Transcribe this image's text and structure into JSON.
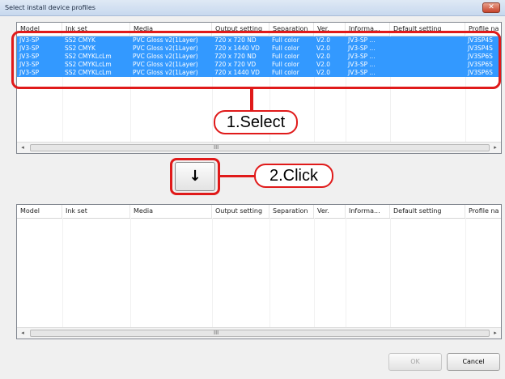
{
  "window": {
    "title": "Select install device profiles",
    "close_label": "✕"
  },
  "columns": [
    "Model",
    "Ink set",
    "Media",
    "Output setting",
    "Separation",
    "Ver.",
    "Informa...",
    "Default setting",
    "Profile na"
  ],
  "top_list": {
    "rows": [
      [
        "JV3-SP",
        "SS2 CMYK",
        "PVC Gloss v2(1Layer)",
        "720 x 720 ND",
        "Full color",
        "V2.0",
        "JV3-SP ...",
        "",
        "JV3SP4S"
      ],
      [
        "JV3-SP",
        "SS2 CMYK",
        "PVC Gloss v2(1Layer)",
        "720 x 1440 VD",
        "Full color",
        "V2.0",
        "JV3-SP ...",
        "",
        "JV3SP4S"
      ],
      [
        "JV3-SP",
        "SS2 CMYKLcLm",
        "PVC Gloss v2(1Layer)",
        "720 x 720 ND",
        "Full color",
        "V2.0",
        "JV3-SP ...",
        "",
        "JV3SP6S"
      ],
      [
        "JV3-SP",
        "SS2 CMYKLcLm",
        "PVC Gloss v2(1Layer)",
        "720 x 720 VD",
        "Full color",
        "V2.0",
        "JV3-SP ...",
        "",
        "JV3SP6S"
      ],
      [
        "JV3-SP",
        "SS2 CMYKLcLm",
        "PVC Gloss v2(1Layer)",
        "720 x 1440 VD",
        "Full color",
        "V2.0",
        "JV3-SP ...",
        "",
        "JV3SP6S"
      ]
    ]
  },
  "bottom_list": {
    "rows": []
  },
  "scrollbar": {
    "left_arrow": "◂",
    "right_arrow": "▸",
    "grip": "III"
  },
  "move_button": {
    "label": "↓"
  },
  "annotations": {
    "step1": "1.Select",
    "step2": "2.Click"
  },
  "buttons": {
    "ok": "OK",
    "cancel": "Cancel"
  },
  "colors": {
    "selection": "#3399ff",
    "annotation": "#e01a1a"
  }
}
